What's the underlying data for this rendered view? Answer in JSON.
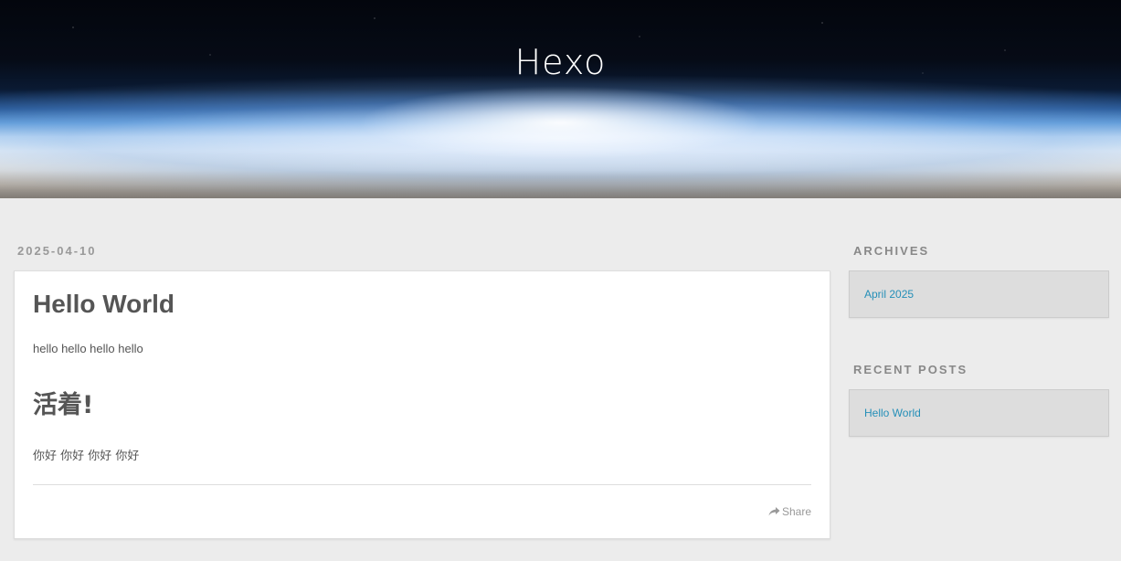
{
  "site": {
    "title": "Hexo"
  },
  "article": {
    "date": "2025-04-10",
    "title": "Hello World",
    "paragraph1": "hello hello hello hello",
    "heading2": "活着!",
    "paragraph2": "你好 你好 你好 你好",
    "share_label": "Share",
    "share_icon": "share-arrow-icon"
  },
  "sidebar": {
    "archives": {
      "title": "Archives",
      "items": [
        "April 2025"
      ]
    },
    "recent_posts": {
      "title": "Recent Posts",
      "items": [
        "Hello World"
      ]
    }
  },
  "colors": {
    "background": "#ececec",
    "link": "#258fb8",
    "text": "#555555",
    "muted": "#999999"
  }
}
